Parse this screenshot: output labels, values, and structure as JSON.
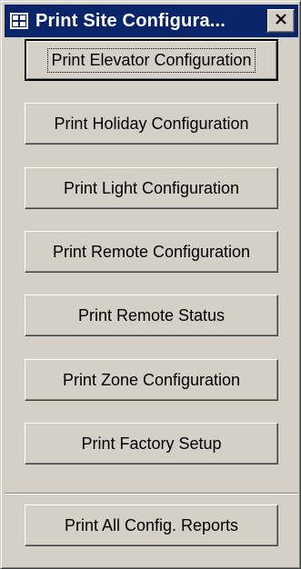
{
  "window": {
    "title": "Print Site Configura...",
    "icon": "form-icon",
    "close_icon": "close-icon"
  },
  "buttons": [
    {
      "label": "Print Elevator Configuration"
    },
    {
      "label": "Print Holiday Configuration"
    },
    {
      "label": "Print Light Configuration"
    },
    {
      "label": "Print Remote Configuration"
    },
    {
      "label": "Print Remote Status"
    },
    {
      "label": "Print Zone Configuration"
    },
    {
      "label": "Print Factory Setup"
    },
    {
      "label": "Print All Config. Reports"
    }
  ],
  "colors": {
    "titlebar": "#0a246a",
    "face": "#d4d0c8"
  }
}
